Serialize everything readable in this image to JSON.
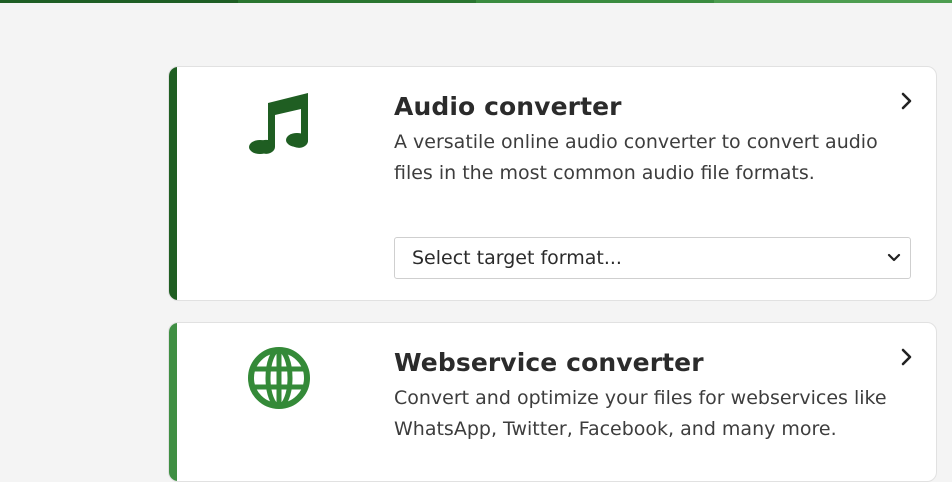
{
  "colors": {
    "top_bar": [
      "#1e5e24",
      "#2a7530",
      "#3a8b3f",
      "#4d9d50"
    ],
    "audio_accent": "#1f5e22",
    "webservice_accent": "#3f8f43",
    "audio_icon": "#1f5e22",
    "webservice_icon": "#348a38"
  },
  "audio_converter": {
    "icon": "music-note-icon",
    "title": "Audio converter",
    "description": "A versatile online audio converter to convert audio files in the most common audio file formats.",
    "select_placeholder": "Select target format..."
  },
  "webservice_converter": {
    "icon": "globe-icon",
    "title": "Webservice converter",
    "description": "Convert and optimize your files for webservices like WhatsApp, Twitter, Facebook, and many more."
  }
}
